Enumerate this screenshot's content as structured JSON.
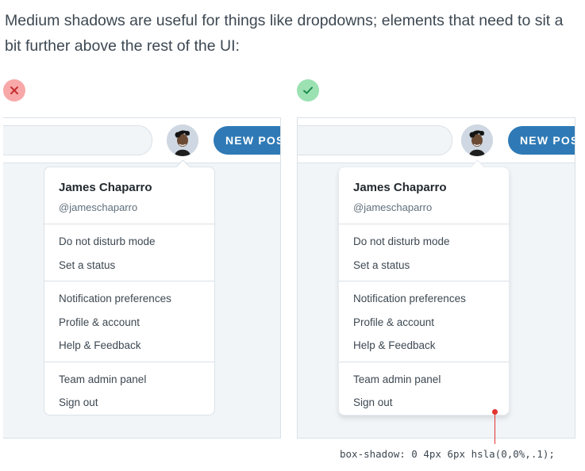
{
  "intro": "Medium shadows are useful for things like dropdowns; elements that need to sit a bit further above the rest of the UI:",
  "colors": {
    "bad_badge": "#f8a8a8",
    "good_badge": "#9be1b2",
    "button": "#2f7ab6",
    "pointer": "#e3342f"
  },
  "examples": {
    "bad": {
      "icon": "x-icon"
    },
    "good": {
      "icon": "check-icon"
    }
  },
  "header": {
    "button_label": "NEW POST"
  },
  "menu": {
    "name": "James Chaparro",
    "handle": "@jameschaparro",
    "groups": [
      [
        "Do not disturb mode",
        "Set a status"
      ],
      [
        "Notification preferences",
        "Profile & account",
        "Help & Feedback"
      ],
      [
        "Team admin panel",
        "Sign out"
      ]
    ]
  },
  "annotation": "box-shadow: 0 4px 6px hsla(0,0%,.1);"
}
